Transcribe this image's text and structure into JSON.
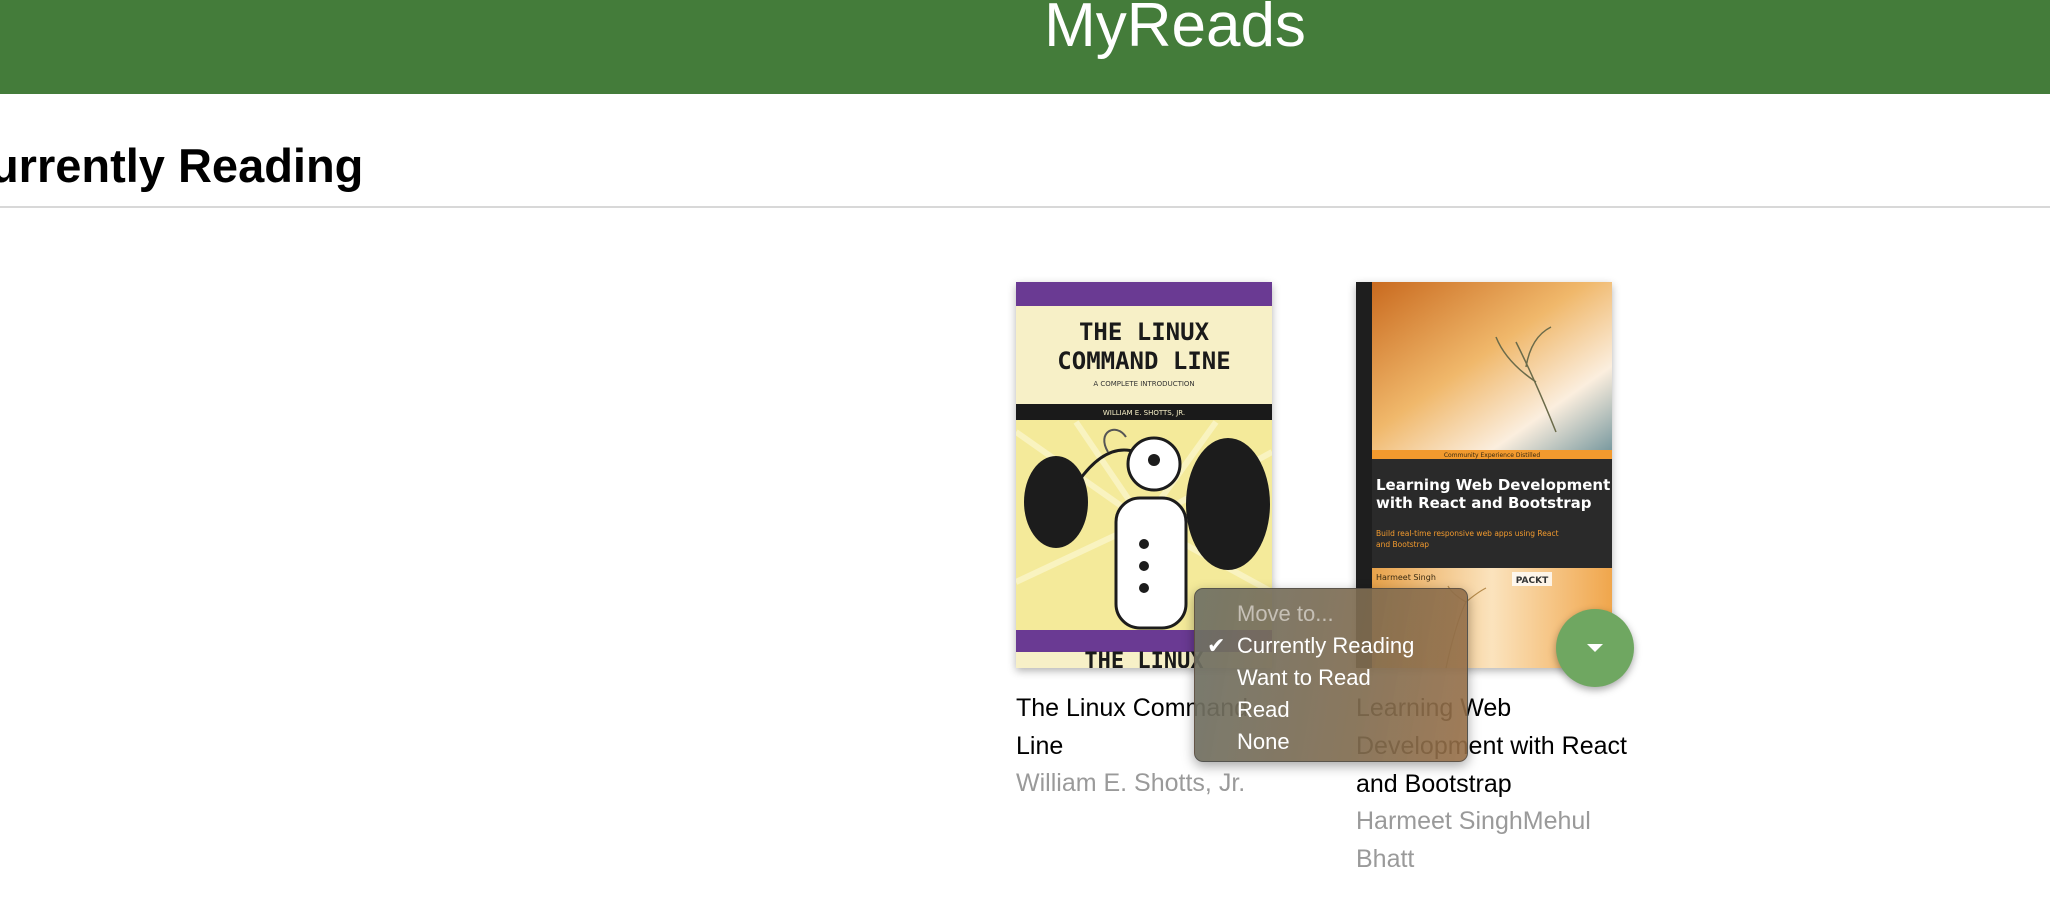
{
  "header": {
    "title": "MyReads"
  },
  "shelf": {
    "title": "Currently Reading"
  },
  "books": [
    {
      "title": "The Linux Command Line",
      "authors": "William E. Shotts, Jr.",
      "cover": {
        "title_line1": "THE LINUX",
        "title_line2": "COMMAND LINE",
        "subtitle": "A COMPLETE INTRODUCTION",
        "author": "WILLIAM E. SHOTTS, JR.",
        "footer": "THE LINUX"
      }
    },
    {
      "title": "Learning Web Development with React and Bootstrap",
      "authors": "Harmeet SinghMehul Bhatt",
      "cover": {
        "banner": "Community Experience Distilled",
        "title": "Learning Web Development with React and Bootstrap",
        "subtitle": "Build real-time responsive web apps using React and Bootstrap",
        "author": "Harmeet Singh",
        "publisher": "PACKT"
      }
    }
  ],
  "move_menu": {
    "header": "Move to...",
    "options": [
      {
        "label": "Currently Reading",
        "checked": true
      },
      {
        "label": "Want to Read",
        "checked": false
      },
      {
        "label": "Read",
        "checked": false
      },
      {
        "label": "None",
        "checked": false
      }
    ],
    "check_glyph": "✔"
  },
  "colors": {
    "header_bg": "#447c3a",
    "changer_bg": "#6fa761",
    "author_text": "#9a9a9a"
  },
  "icons": {
    "shelf_changer": "caret-down-icon",
    "checked_option": "checkmark-icon"
  }
}
